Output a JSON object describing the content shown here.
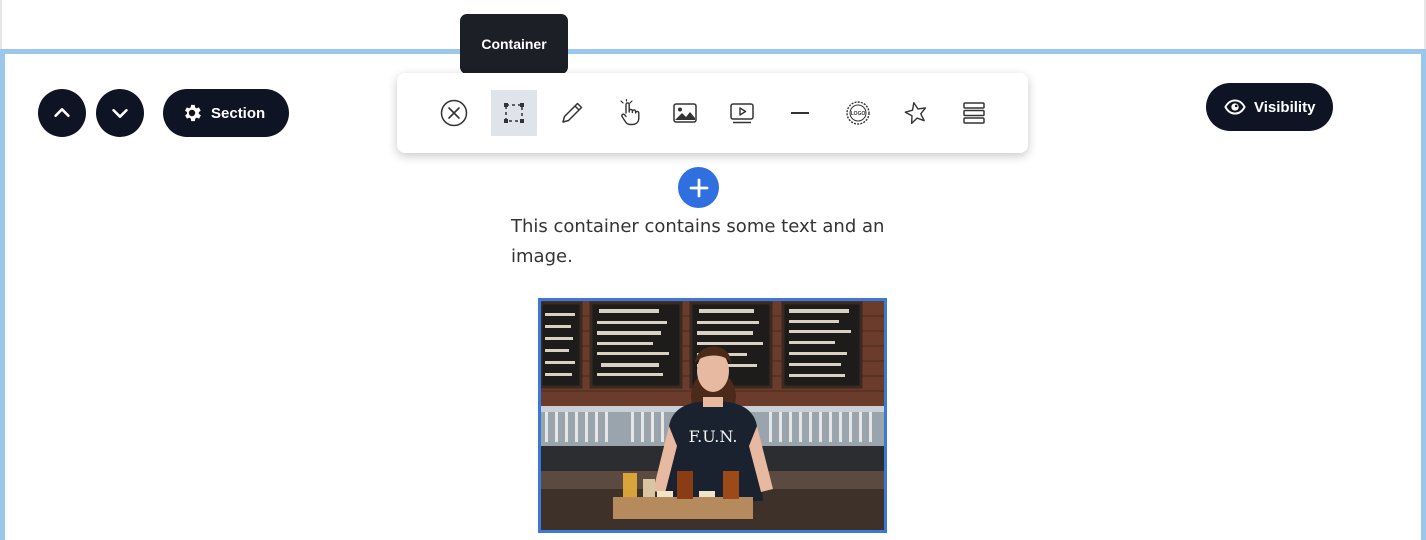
{
  "section_controls": {
    "move_up_icon": "chevron-up-icon",
    "move_down_icon": "chevron-down-icon",
    "section_label": "Section",
    "visibility_label": "Visibility"
  },
  "toolbar": {
    "tooltip": "Container",
    "tools": [
      {
        "name": "close",
        "icon": "close-circle-icon"
      },
      {
        "name": "container",
        "icon": "container-icon",
        "active": true
      },
      {
        "name": "edit",
        "icon": "pencil-icon"
      },
      {
        "name": "button",
        "icon": "pointer-hand-icon"
      },
      {
        "name": "image",
        "icon": "image-icon"
      },
      {
        "name": "video",
        "icon": "video-icon"
      },
      {
        "name": "divider",
        "icon": "divider-icon"
      },
      {
        "name": "logo",
        "icon": "logo-badge-icon"
      },
      {
        "name": "icon",
        "icon": "star-icon"
      },
      {
        "name": "rows",
        "icon": "rows-icon"
      }
    ]
  },
  "content": {
    "text": "This container contains some text and an image.",
    "image_sign_line1": "F.U.N."
  },
  "colors": {
    "dark": "#0f1424",
    "frame": "#9bc7ec",
    "accent": "#2f6fe0",
    "image_border": "#3b78d8"
  }
}
